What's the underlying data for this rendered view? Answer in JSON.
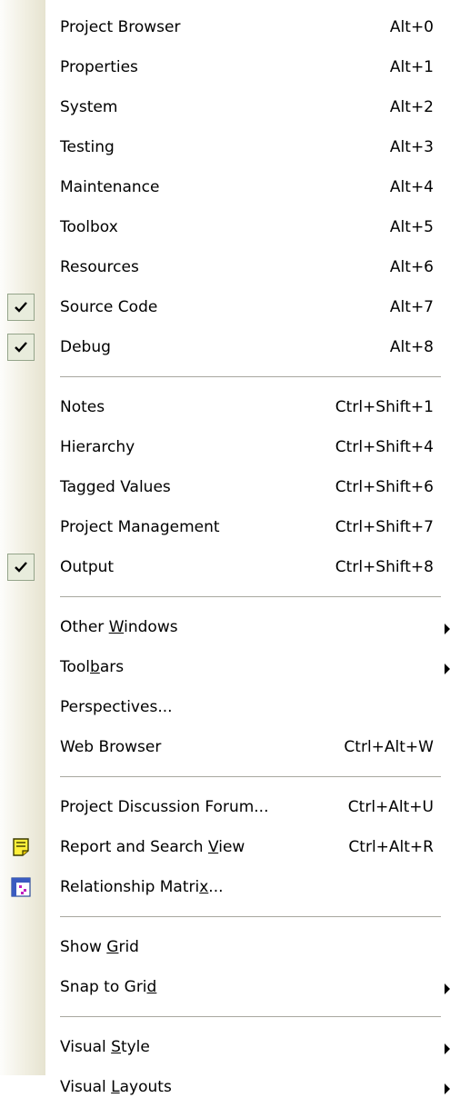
{
  "menu": {
    "group1": [
      {
        "label": "Project Browser",
        "shortcut": "Alt+0",
        "checked": false
      },
      {
        "label": "Properties",
        "shortcut": "Alt+1",
        "checked": false
      },
      {
        "label": "System",
        "shortcut": "Alt+2",
        "checked": false
      },
      {
        "label": "Testing",
        "shortcut": "Alt+3",
        "checked": false
      },
      {
        "label": "Maintenance",
        "shortcut": "Alt+4",
        "checked": false
      },
      {
        "label": "Toolbox",
        "shortcut": "Alt+5",
        "checked": false
      },
      {
        "label": "Resources",
        "shortcut": "Alt+6",
        "checked": false
      },
      {
        "label": "Source Code",
        "shortcut": "Alt+7",
        "checked": true
      },
      {
        "label": "Debug",
        "shortcut": "Alt+8",
        "checked": true
      }
    ],
    "group2": [
      {
        "label": "Notes",
        "shortcut": "Ctrl+Shift+1",
        "checked": false
      },
      {
        "label": "Hierarchy",
        "shortcut": "Ctrl+Shift+4",
        "checked": false
      },
      {
        "label": "Tagged Values",
        "shortcut": "Ctrl+Shift+6",
        "checked": false
      },
      {
        "label": "Project Management",
        "shortcut": "Ctrl+Shift+7",
        "checked": false
      },
      {
        "label": "Output",
        "shortcut": "Ctrl+Shift+8",
        "checked": true
      }
    ],
    "group3": [
      {
        "label_pre": "Other ",
        "label_u": "W",
        "label_post": "indows",
        "shortcut": "",
        "submenu": true
      },
      {
        "label_pre": "Tool",
        "label_u": "b",
        "label_post": "ars",
        "shortcut": "",
        "submenu": true
      },
      {
        "label_pre": "Perspectives...",
        "label_u": "",
        "label_post": "",
        "shortcut": "",
        "submenu": false
      },
      {
        "label_pre": "Web Browser",
        "label_u": "",
        "label_post": "",
        "shortcut": "Ctrl+Alt+W",
        "submenu": false
      }
    ],
    "group4": [
      {
        "label_pre": "Project Discussion Forum...",
        "label_u": "",
        "label_post": "",
        "shortcut": "Ctrl+Alt+U",
        "icon": ""
      },
      {
        "label_pre": "Report and Search ",
        "label_u": "V",
        "label_post": "iew",
        "shortcut": "Ctrl+Alt+R",
        "icon": "report-icon"
      },
      {
        "label_pre": "Relationship Matri",
        "label_u": "x",
        "label_post": "...",
        "shortcut": "",
        "icon": "matrix-icon"
      }
    ],
    "group5": [
      {
        "label_pre": "Show ",
        "label_u": "G",
        "label_post": "rid",
        "submenu": false
      },
      {
        "label_pre": "Snap to Gri",
        "label_u": "d",
        "label_post": "",
        "submenu": true
      }
    ],
    "group6": [
      {
        "label_pre": "Visual ",
        "label_u": "S",
        "label_post": "tyle",
        "submenu": true
      },
      {
        "label_pre": "Visual ",
        "label_u": "L",
        "label_post": "ayouts",
        "submenu": true
      }
    ],
    "colors": {
      "gutter": "#f1efe2",
      "check_bg": "#e8ecdc",
      "check_border": "#94a48a",
      "separator": "#a8a79f"
    }
  }
}
